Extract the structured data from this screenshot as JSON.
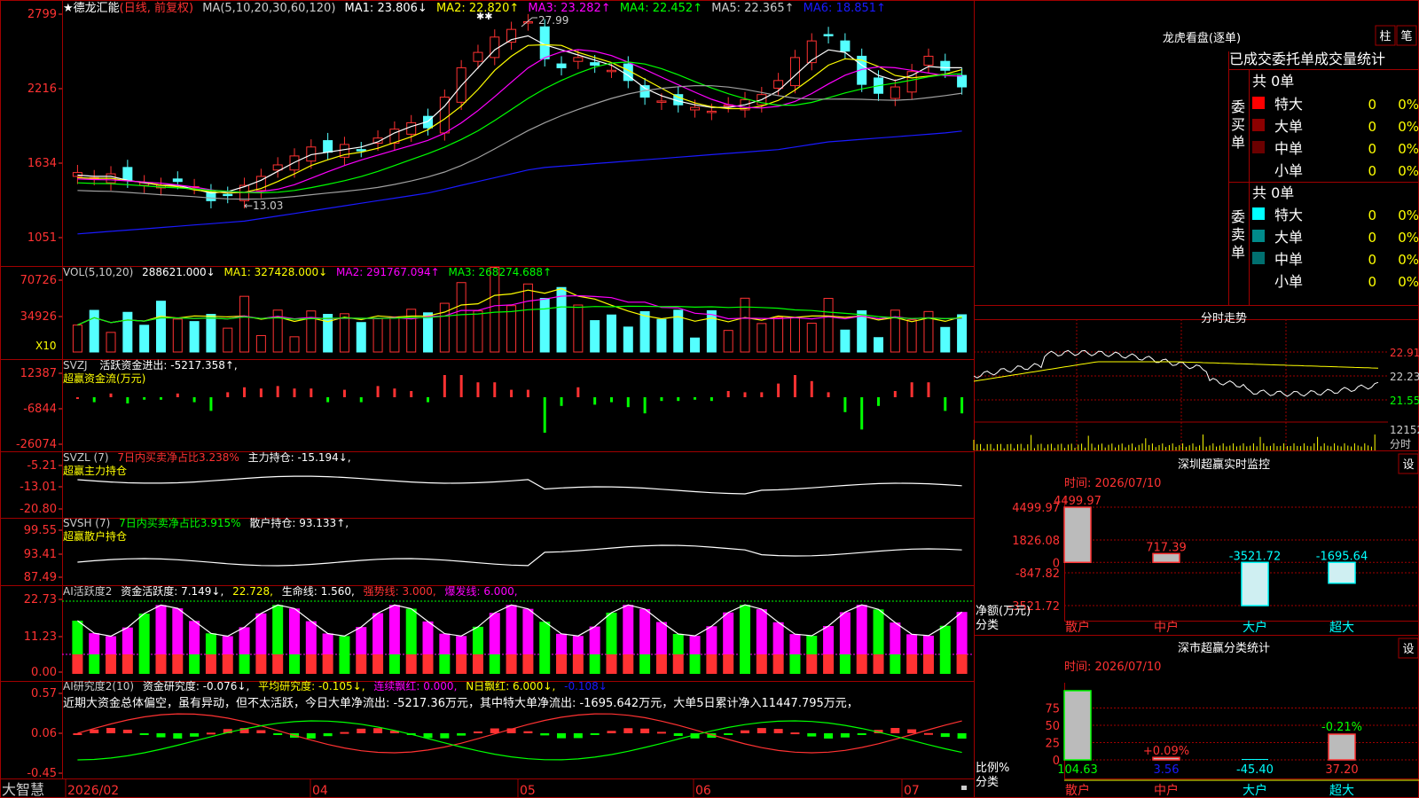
{
  "colors": {
    "up": "#ff3232",
    "down": "#54ffff",
    "grid": "#a00000",
    "ma1": "#ffffff",
    "ma2": "#ffff00",
    "ma3": "#ff00ff",
    "ma4": "#00ff00",
    "ma5": "#a0a0a0",
    "ma6": "#1a1aff",
    "title_red": "#ff3232",
    "label_yellow": "#ffff00",
    "text_grey": "#cccccc"
  },
  "main": {
    "star": "★",
    "stock": "德龙汇能",
    "mode": "(日线, 前复权)",
    "ma_prefix": "MA(5,10,20,30,60,120)",
    "ma1": "MA1: 23.806↓",
    "ma2": "MA2: 22.820↑",
    "ma3": "MA3: 23.282↑",
    "ma4": "MA4: 22.452↑",
    "ma5": "MA5: 22.365↑",
    "ma6": "MA6: 18.851↑",
    "yticks": [
      "2799",
      "2216",
      "1634",
      "1051"
    ],
    "high_label": "27.99",
    "low_label": "←13.03",
    "markers": "✱✱"
  },
  "vol": {
    "title": "VOL(5,10,20)",
    "val": "288621.000↓",
    "ma1": "MA1: 327428.000↓",
    "ma2": "MA2: 291767.094↑",
    "ma3": "MA3: 268274.688↑",
    "yticks": [
      "70726",
      "34926"
    ],
    "unit": "X10"
  },
  "svzj": {
    "title": "SVZJ",
    "text": "活跃资金进出: -5217.358↑,",
    "sub": "超赢资金流(万元)",
    "yticks": [
      "12387",
      "-6844",
      "-26074"
    ]
  },
  "svzl": {
    "title": "SVZL (7)",
    "text1": "7日内买卖净占比3.238%",
    "text2": "主力持仓: -15.194↓,",
    "sub": "超赢主力持仓",
    "yticks": [
      "-5.21",
      "-13.01",
      "-20.80"
    ]
  },
  "svsh": {
    "title": "SVSH (7)",
    "text1": "7日内买卖净占比3.915%",
    "text2": "散户持仓: 93.133↑,",
    "sub": "超赢散户持仓",
    "yticks": [
      "99.55",
      "93.41",
      "87.49"
    ]
  },
  "ai1": {
    "title": "AI活跃度2",
    "t1": "资金活跃度: 7.149↓,",
    "t2": "22.728,",
    "t3": "生命线: 1.560,",
    "t4": "强势线: 3.000,",
    "t5": "爆发线: 6.000,",
    "yticks": [
      "22.73",
      "11.23",
      "0.00"
    ]
  },
  "ai2": {
    "title": "AI研究度2(10)",
    "t1": "资金研究度: -0.076↓,",
    "t2": "平均研究度: -0.105↓,",
    "t3": "连续飘红: 0.000,",
    "t4": "N日飘红: 6.000↓,",
    "t5": "-0.108↓",
    "desc": "近期大资金总体偏空，虽有异动，但不太活跃，今日大单净流出: -5217.36万元，其中特大单净流出: -1695.642万元，大单5日累计净入11447.795万元，",
    "yticks": [
      "0.57",
      "0.06",
      "-0.45"
    ]
  },
  "xaxis": {
    "logo": "大智慧",
    "labels": [
      "2026/02",
      "04",
      "05",
      "06",
      "07"
    ]
  },
  "lhb": {
    "title": "龙虎看盘(逐单)",
    "btn1": "柱",
    "btn2": "笔",
    "tab1": "已成交",
    "tab2": "委托单",
    "tab3": "成交量统计",
    "buy_label": "委买单",
    "sell_label": "委卖单",
    "buy_total": "共 0单",
    "sell_total": "共 0单",
    "buy_rows": [
      {
        "name": "特大",
        "count": "0",
        "pct": "0%",
        "color": "#ff0000"
      },
      {
        "name": "大单",
        "count": "0",
        "pct": "0%",
        "color": "#8b0000"
      },
      {
        "name": "中单",
        "count": "0",
        "pct": "0%",
        "color": "#6b0000"
      },
      {
        "name": "小单",
        "count": "0",
        "pct": "0%",
        "color": ""
      }
    ],
    "sell_rows": [
      {
        "name": "特大",
        "count": "0",
        "pct": "0%",
        "color": "#00ffff"
      },
      {
        "name": "大单",
        "count": "0",
        "pct": "0%",
        "color": "#008b8b"
      },
      {
        "name": "中单",
        "count": "0",
        "pct": "0%",
        "color": "#007070"
      },
      {
        "name": "小单",
        "count": "0",
        "pct": "0%",
        "color": ""
      }
    ]
  },
  "fenshi": {
    "title": "分时走势",
    "yticks": [
      "22.91",
      "22.23",
      "21.55"
    ],
    "vol_label": "12152",
    "vol_sub": "分时"
  },
  "shenzhen_monitor": {
    "title": "深圳超赢实时监控",
    "btn": "设",
    "time": "时间: 2026/07/10",
    "yticks": [
      "4499.97",
      "1826.08",
      "0",
      "-847.82",
      "-3521.72"
    ],
    "ylabel1": "净额(万元)",
    "ylabel2": "分类",
    "categories": [
      "散户",
      "中户",
      "大户",
      "超大"
    ],
    "values": [
      4499.97,
      717.39,
      -3521.72,
      -1695.64
    ],
    "value_labels": [
      "4499.97",
      "717.39",
      "-3521.72",
      "-1695.64"
    ]
  },
  "shenzhen_class": {
    "title": "深市超赢分类统计",
    "btn": "设",
    "time": "时间: 2026/07/10",
    "yticks": [
      "75",
      "50",
      "25",
      "0"
    ],
    "ylabel1": "比例%",
    "ylabel2": "分类",
    "categories": [
      "散户",
      "中户",
      "大户",
      "超大"
    ],
    "values": [
      104.63,
      3.56,
      -45.4,
      37.2
    ],
    "value_labels": [
      "104.63",
      "3.56",
      "-45.40",
      "37.20"
    ],
    "pct_labels": [
      "",
      "+0.09%",
      "",
      "-0.21%"
    ]
  },
  "chart_data": [
    {
      "type": "bar",
      "title": "深圳超赢实时监控",
      "categories": [
        "散户",
        "中户",
        "大户",
        "超大"
      ],
      "values": [
        4499.97,
        717.39,
        -3521.72,
        -1695.64
      ],
      "ylim": [
        -3521.72,
        4499.97
      ]
    },
    {
      "type": "bar",
      "title": "深市超赢分类统计",
      "categories": [
        "散户",
        "中户",
        "大户",
        "超大"
      ],
      "values": [
        104.63,
        3.56,
        -45.4,
        37.2
      ],
      "ylim": [
        0,
        100
      ]
    },
    {
      "type": "line",
      "title": "德龙汇能 (日线, 前复权)",
      "x": [
        "2026/02",
        "04",
        "05",
        "06",
        "07"
      ],
      "ylim": [
        10.51,
        27.99
      ],
      "series": [
        {
          "name": "close",
          "values": [
            15.6,
            15.2,
            15.5,
            15.0,
            14.8,
            14.6,
            14.9,
            14.5,
            13.4,
            13.8,
            14.6,
            15.3,
            16.2,
            16.9,
            17.6,
            17.2,
            17.8,
            17.4,
            18.3,
            19.0,
            19.5,
            19.1,
            21.5,
            23.8,
            25.0,
            26.2,
            26.8,
            27.4,
            24.5,
            23.8,
            24.6,
            24.0,
            23.6,
            22.8,
            21.5,
            21.2,
            20.9,
            20.7,
            20.4,
            20.9,
            21.3,
            21.7,
            22.8,
            24.6,
            25.9,
            26.3,
            25.1,
            22.5,
            21.8,
            22.3,
            23.5,
            24.7,
            23.6,
            22.3
          ]
        },
        {
          "name": "MA1",
          "values": [
            15.4,
            15.3,
            15.3,
            15.0,
            14.8,
            14.6,
            14.6,
            14.3,
            14.0,
            14.1,
            14.5,
            15.0,
            15.7,
            16.4,
            17.0,
            17.2,
            17.4,
            17.6,
            18.0,
            18.7,
            19.2,
            19.6,
            20.8,
            22.4,
            23.8,
            25.2,
            26.0,
            26.3,
            25.6,
            25.2,
            24.8,
            24.4,
            24.0,
            23.2,
            22.2,
            21.6,
            21.2,
            20.9,
            20.7,
            20.7,
            20.9,
            21.3,
            22.0,
            23.2,
            24.4,
            25.2,
            25.0,
            24.0,
            23.2,
            22.8,
            23.2,
            23.9,
            23.8,
            23.8
          ]
        },
        {
          "name": "MA6",
          "values": [
            10.8,
            10.9,
            11.0,
            11.1,
            11.2,
            11.3,
            11.4,
            11.5,
            11.6,
            11.7,
            11.8,
            12.0,
            12.2,
            12.4,
            12.6,
            12.8,
            13.0,
            13.2,
            13.4,
            13.6,
            13.8,
            14.0,
            14.3,
            14.6,
            14.9,
            15.2,
            15.5,
            15.8,
            16.0,
            16.1,
            16.2,
            16.3,
            16.4,
            16.5,
            16.6,
            16.7,
            16.8,
            16.9,
            17.0,
            17.1,
            17.2,
            17.3,
            17.4,
            17.6,
            17.8,
            18.0,
            18.1,
            18.2,
            18.3,
            18.4,
            18.5,
            18.6,
            18.7,
            18.85
          ]
        }
      ]
    }
  ]
}
